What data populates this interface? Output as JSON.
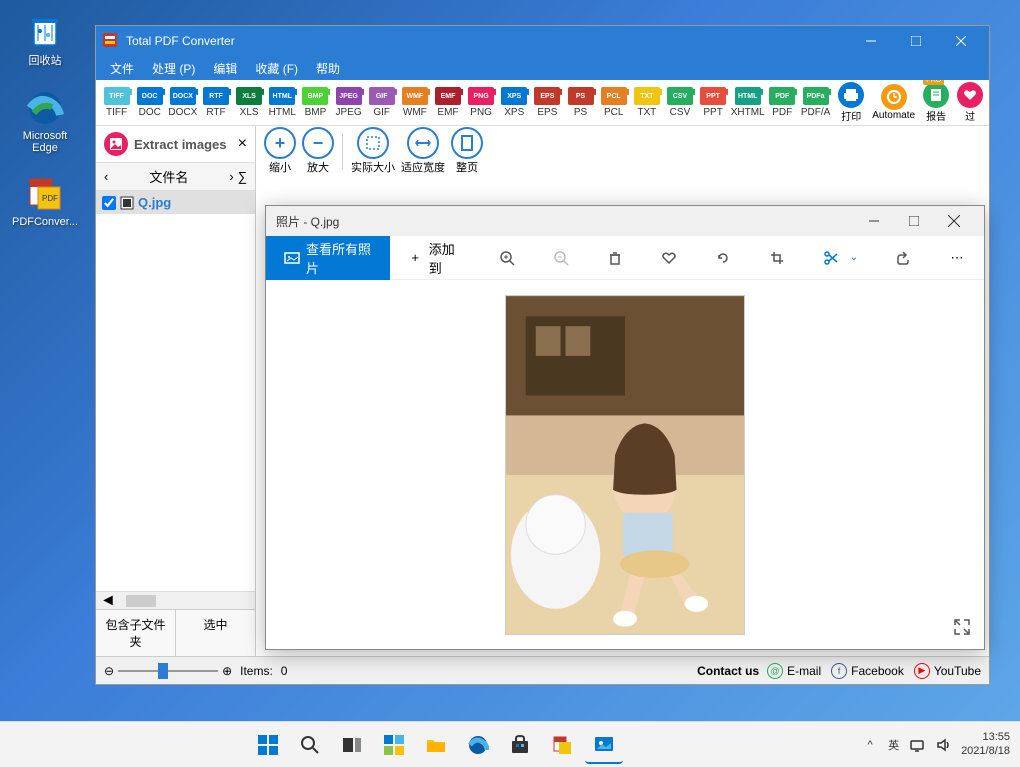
{
  "desktop": {
    "icons": [
      {
        "name": "recycle-bin",
        "label": "回收站"
      },
      {
        "name": "edge",
        "label": "Microsoft Edge"
      },
      {
        "name": "pdfconverter",
        "label": "PDFConver..."
      }
    ]
  },
  "app": {
    "title": "Total PDF Converter",
    "menu": [
      "文件",
      "处理 (P)",
      "编辑",
      "收藏 (F)",
      "帮助"
    ],
    "formats": [
      {
        "label": "TIFF",
        "color": "#4fc3d9",
        "text": "TIFF"
      },
      {
        "label": "DOC",
        "color": "#0078d4",
        "text": "DOC"
      },
      {
        "label": "DOCX",
        "color": "#0078d4",
        "text": "DOCX"
      },
      {
        "label": "RTF",
        "color": "#0078d4",
        "text": "RTF"
      },
      {
        "label": "XLS",
        "color": "#0d7c3f",
        "text": "XLS"
      },
      {
        "label": "HTML",
        "color": "#0078d4",
        "text": "HTML"
      },
      {
        "label": "BMP",
        "color": "#4cd137",
        "text": "BMP"
      },
      {
        "label": "JPEG",
        "color": "#8e44ad",
        "text": "JPEG"
      },
      {
        "label": "GIF",
        "color": "#9b59b6",
        "text": "GIF"
      },
      {
        "label": "WMF",
        "color": "#e67e22",
        "text": "WMF"
      },
      {
        "label": "EMF",
        "color": "#ad1f2d",
        "text": "EMF"
      },
      {
        "label": "PNG",
        "color": "#e91e63",
        "text": "PNG"
      },
      {
        "label": "XPS",
        "color": "#0078d4",
        "text": "XPS"
      },
      {
        "label": "EPS",
        "color": "#c0392b",
        "text": "EPS"
      },
      {
        "label": "PS",
        "color": "#c0392b",
        "text": "PS"
      },
      {
        "label": "PCL",
        "color": "#e67e22",
        "text": "PCL"
      },
      {
        "label": "TXT",
        "color": "#f1c40f",
        "text": "TXT"
      },
      {
        "label": "CSV",
        "color": "#27ae60",
        "text": "CSV"
      },
      {
        "label": "PPT",
        "color": "#e74c3c",
        "text": "PPT"
      },
      {
        "label": "XHTML",
        "color": "#16a085",
        "text": "HTML"
      },
      {
        "label": "PDF",
        "color": "#27ae60",
        "text": "PDF"
      },
      {
        "label": "PDF/A",
        "color": "#27ae60",
        "text": "PDFa"
      }
    ],
    "actions": [
      {
        "label": "打印",
        "color": "#0078d4",
        "icon": "print"
      },
      {
        "label": "Automate",
        "color": "#f39c12",
        "icon": "clock"
      },
      {
        "label": "报告",
        "color": "#27ae60",
        "icon": "report",
        "badge": "PRO"
      },
      {
        "label": "过",
        "color": "#e91e63",
        "icon": "heart"
      }
    ],
    "sidebar": {
      "header": "Extract images",
      "column_header": "文件名",
      "files": [
        {
          "name": "Q.jpg",
          "checked": true
        }
      ],
      "footer_buttons": [
        "包含子文件夹",
        "选中"
      ]
    },
    "view_buttons": [
      {
        "label": "缩小",
        "icon": "plus"
      },
      {
        "label": "放大",
        "icon": "minus"
      },
      {
        "label": "实际大小",
        "icon": "fit"
      },
      {
        "label": "适应宽度",
        "icon": "width"
      },
      {
        "label": "整页",
        "icon": "page"
      }
    ],
    "status": {
      "items_label": "Items:",
      "items_count": "0",
      "contact": "Contact us",
      "links": [
        {
          "label": "E-mail",
          "icon": "@",
          "color": "#27ae60"
        },
        {
          "label": "Facebook",
          "icon": "f",
          "color": "#3b5998"
        },
        {
          "label": "YouTube",
          "icon": "▶",
          "color": "#ff0000"
        }
      ]
    }
  },
  "photos": {
    "title": "照片 - Q.jpg",
    "view_all": "查看所有照片",
    "add_to": "添加到",
    "image_name": "Q.jpg"
  },
  "taskbar": {
    "tray": {
      "chevron": "^",
      "lang": "英",
      "time": "13:55",
      "date": "2021/8/18"
    }
  }
}
